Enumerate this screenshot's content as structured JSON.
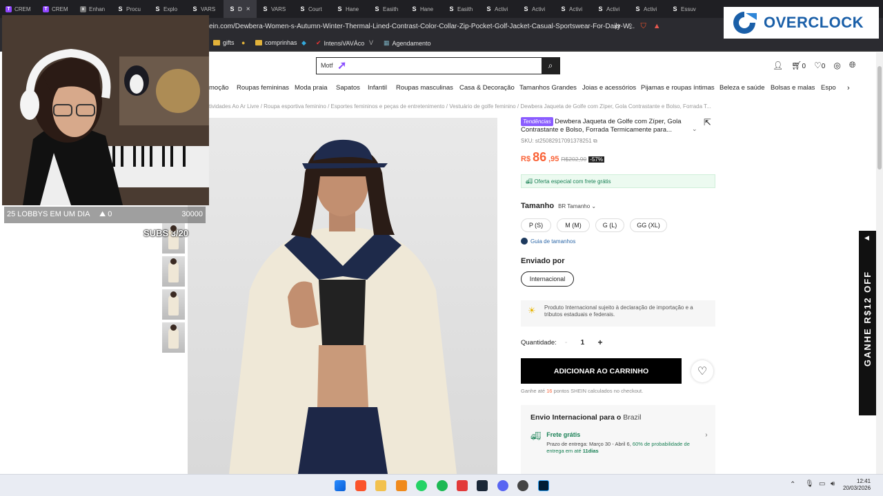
{
  "browser": {
    "tabs": [
      {
        "label": "CREM",
        "fav": "T"
      },
      {
        "label": "CREM",
        "fav": "T"
      },
      {
        "label": "Enhan",
        "fav": "x"
      },
      {
        "label": "Procu",
        "fav": "S"
      },
      {
        "label": "Explo",
        "fav": "S"
      },
      {
        "label": "VARS",
        "fav": "S"
      },
      {
        "label": "D",
        "fav": "S"
      },
      {
        "label": "VARS",
        "fav": "S"
      },
      {
        "label": "Court",
        "fav": "S"
      },
      {
        "label": "Hane",
        "fav": "S"
      },
      {
        "label": "Easith",
        "fav": "S"
      },
      {
        "label": "Hane",
        "fav": "S"
      },
      {
        "label": "Easith",
        "fav": "S"
      },
      {
        "label": "Activi",
        "fav": "S"
      },
      {
        "label": "Activi",
        "fav": "S"
      },
      {
        "label": "Activi",
        "fav": "S"
      },
      {
        "label": "Activi",
        "fav": "S"
      },
      {
        "label": "Activi",
        "fav": "S"
      },
      {
        "label": "Essuv",
        "fav": "S"
      }
    ],
    "active_tab_close": "×",
    "url": "ein.com/Dewbera-Women-s-Autumn-Winter-Thermal-Lined-Contrast-Color-Collar-Zip-Pocket-Golf-Jacket-Casual-Sportswear-For-Daily-W...",
    "bookmarks": [
      "gifts",
      "comprinhas",
      "IntensiVAVÁco",
      "Agendamento"
    ]
  },
  "overlay": {
    "lobbies": "25 LOBBYS EM UM DIA",
    "lobbies_count": "0",
    "goal": "30000",
    "subs": "SUBS 3/20",
    "brand": "OVERCLOCK"
  },
  "site": {
    "search_value": "Motf",
    "cart_count": "0",
    "wish_count": "0",
    "categories": [
      "moção",
      "Roupas femininas",
      "Moda praia",
      "Sapatos",
      "Infantil",
      "Roupas masculinas",
      "Casa & Decoração",
      "Tamanhos Grandes",
      "Joias e acessórios",
      "Pijamas e roupas íntimas",
      "Beleza e saúde",
      "Bolsas e malas",
      "Espo"
    ],
    "breadcrumb": "tividades Ao Ar Livre / Roupa esportiva feminino / Esportes femininos e peças de entretenimento / Vestuário de golfe feminino / Dewbera Jaqueta de Golfe com Zíper, Gola Contrastante e Bolso, Forrada T..."
  },
  "product": {
    "badge": "Tendências",
    "title": "Dewbera Jaqueta de Golfe com Zíper, Gola Contrastante e Bolso, Forrada Termicamente para...",
    "sku": "SKU: st25082917091378251",
    "currency": "R$",
    "price_int": "86",
    "price_dec": ",95",
    "old_price": "R$202,90",
    "discount": "-57%",
    "shipping_offer": "Oferta especial com frete grátis",
    "size_label": "Tamanho",
    "size_system": "BR Tamanho",
    "sizes": [
      "P (S)",
      "M (M)",
      "G (L)",
      "GG (XL)"
    ],
    "size_guide": "Guia de tamanhos",
    "shipped_by_label": "Enviado por",
    "shipped_by": "Internacional",
    "import_note": "Produto Internacional sujeito à declaração de importação e a tributos estaduais e federais.",
    "qty_label": "Quantidade:",
    "qty_minus": "-",
    "qty": "1",
    "qty_plus": "+",
    "add_to_cart": "ADICIONAR AO CARRINHO",
    "points_prefix": "Ganhe até",
    "points_value": "16",
    "points_suffix": "pontos SHEIN calculados no checkout.",
    "envio_title": "Envio Internacional para o",
    "envio_country": "Brazil",
    "free_ship": "Frete grátis",
    "delivery": "Prazo de entrega: Março 30 - Abril 6,",
    "probability": "60% de probabilidade de entrega em até",
    "probability_days": "11dias"
  },
  "promo": {
    "text": "GANHE R$12 OFF"
  },
  "taskbar": {
    "time": "12:41",
    "date": "20/03/2026"
  }
}
